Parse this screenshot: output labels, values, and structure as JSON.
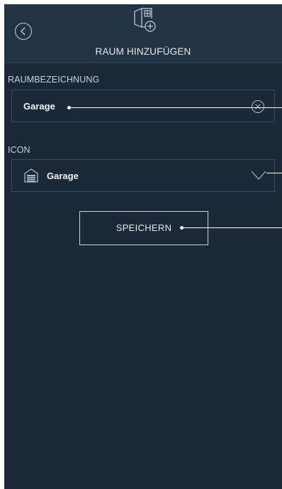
{
  "header": {
    "title": "RAUM HINZUFÜGEN",
    "back_icon": "chevron-left-circle-icon",
    "add_room_icon": "room-plus-icon"
  },
  "form": {
    "name_label": "RAUMBEZEICHNUNG",
    "name_value": "Garage",
    "clear_icon": "clear-circle-icon",
    "icon_label": "ICON",
    "icon_value": "Garage",
    "icon_glyph": "garage-icon",
    "dropdown_icon": "chevron-down-icon"
  },
  "actions": {
    "save_label": "SPEICHERN"
  },
  "colors": {
    "background": "#1a2838",
    "header": "#223346",
    "border": "#3a4c60",
    "text": "#e3e9ef"
  }
}
